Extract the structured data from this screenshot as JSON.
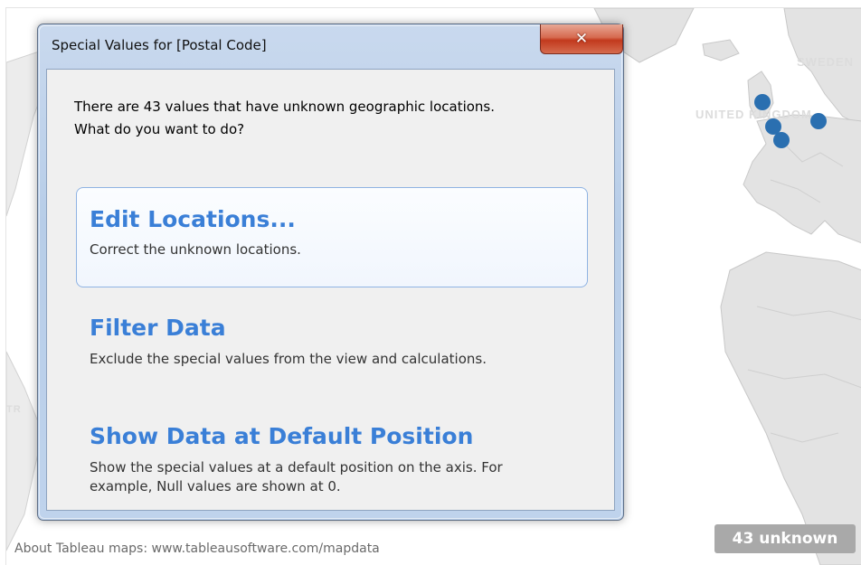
{
  "map": {
    "labels": {
      "sweden": "SWEDEN",
      "uk": "UNITED KINGDOM",
      "left_country": "TR"
    },
    "attribution": "About Tableau maps: www.tableausoftware.com/mapdata",
    "unknown_badge": "43 unknown",
    "marker_color": "#1f77b4"
  },
  "dialog": {
    "title": "Special Values for [Postal Code]",
    "close_glyph": "x",
    "intro_line1": "There are 43 values that have unknown geographic locations.",
    "intro_line2": "What do you want to do?",
    "options": [
      {
        "title": "Edit Locations...",
        "description": "Correct the unknown locations."
      },
      {
        "title": "Filter Data",
        "description": "Exclude the special values from the view and calculations."
      },
      {
        "title": "Show Data at Default Position",
        "description_line1": "Show the special values at a default position on the axis. For",
        "description_line2": "example, Null values are shown at 0."
      }
    ],
    "accent_color": "#3a7fd7"
  }
}
